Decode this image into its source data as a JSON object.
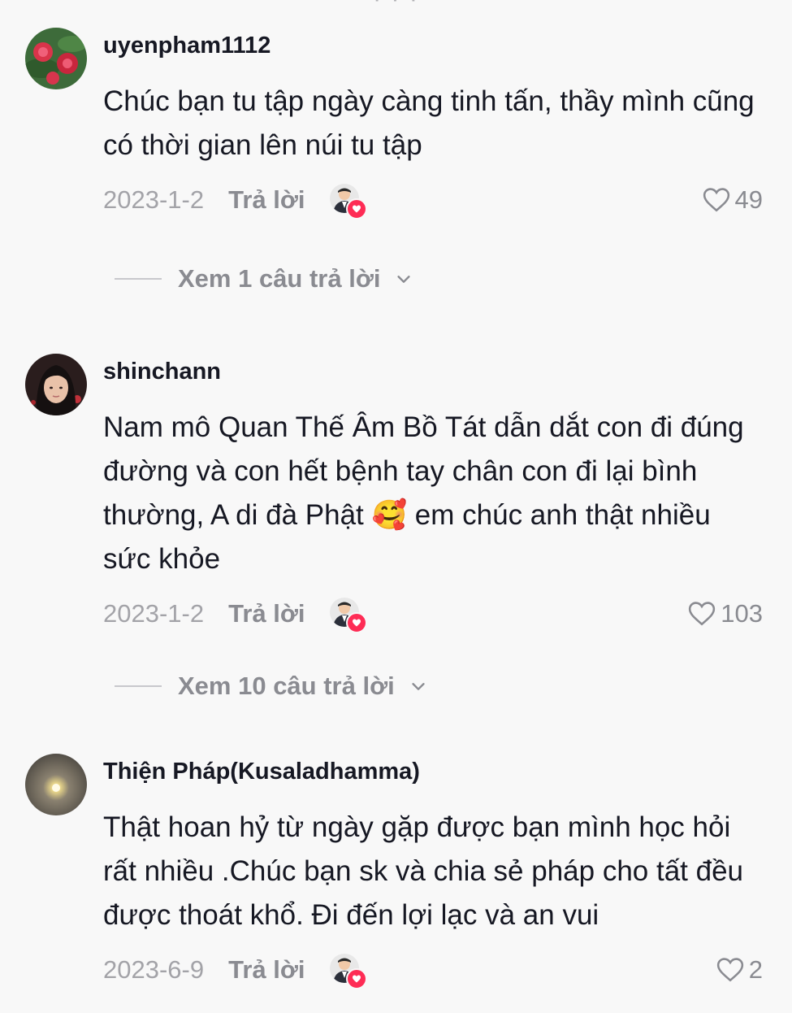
{
  "top_peek": "· · ·",
  "comments": [
    {
      "username": "uyenpham1112",
      "text": "Chúc bạn tu tập ngày càng tinh tấn, thầy mình cũng có thời gian lên núi tu tập",
      "date": "2023-1-2",
      "reply_label": "Trả lời",
      "likes": "49",
      "view_replies": "Xem 1 câu trả lời",
      "avatar_icon": "red-flowers-avatar"
    },
    {
      "username": "shinchann",
      "text": "Nam mô Quan Thế Âm Bồ Tát dẫn dắt con đi đúng đường và con hết bệnh tay chân con đi lại bình thường, A di đà Phật 🥰 em chúc anh thật nhiều sức khỏe",
      "date": "2023-1-2",
      "reply_label": "Trả lời",
      "likes": "103",
      "view_replies": "Xem 10 câu trả lời",
      "avatar_icon": "girl-portrait-avatar"
    },
    {
      "username": "Thiện Pháp(Kusaladhamma)",
      "text": "Thật hoan hỷ từ ngày gặp được bạn mình học hỏi rất nhiều .Chúc bạn sk và chia sẻ pháp cho tất đều được thoát khổ. Đi đến lợi lạc và an vui",
      "date": "2023-6-9",
      "reply_label": "Trả lời",
      "likes": "2",
      "avatar_icon": "glowing-moon-avatar"
    }
  ],
  "colors": {
    "background": "#f8f8f8",
    "text_primary": "#161823",
    "text_secondary": "#8a8b91",
    "date": "#a3a3a8",
    "accent": "#fe2c55"
  }
}
